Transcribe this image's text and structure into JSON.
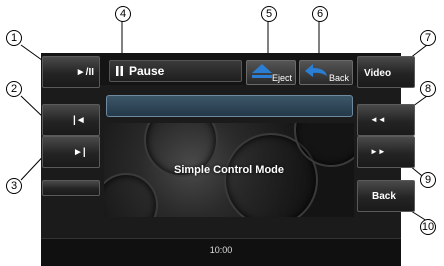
{
  "left_buttons": [
    {
      "label": "►/II",
      "name": "play-pause-button"
    },
    {
      "label": "|◄",
      "name": "prev-track-button"
    },
    {
      "label": "►|",
      "name": "next-track-button"
    },
    {
      "label": "",
      "name": "blank-left-button"
    }
  ],
  "status": {
    "icon": "pause-icon",
    "text": "Pause"
  },
  "eject_button": {
    "label": "Eject"
  },
  "back_top_button": {
    "label": "Back"
  },
  "right_buttons": [
    {
      "label": "Video",
      "name": "video-button"
    },
    {
      "label": "◄◄",
      "name": "rewind-button"
    },
    {
      "label": "►►",
      "name": "fast-forward-button"
    },
    {
      "label": "Back",
      "name": "back-button"
    }
  ],
  "main_panel": {
    "mode_label": "Simple Control Mode"
  },
  "footer": {
    "time": "10:00"
  },
  "callouts": [
    "1",
    "2",
    "3",
    "4",
    "5",
    "6",
    "7",
    "8",
    "9",
    "10"
  ],
  "colors": {
    "accent_blue": "#2a7fd4",
    "progress_blue": "#3c5668"
  }
}
